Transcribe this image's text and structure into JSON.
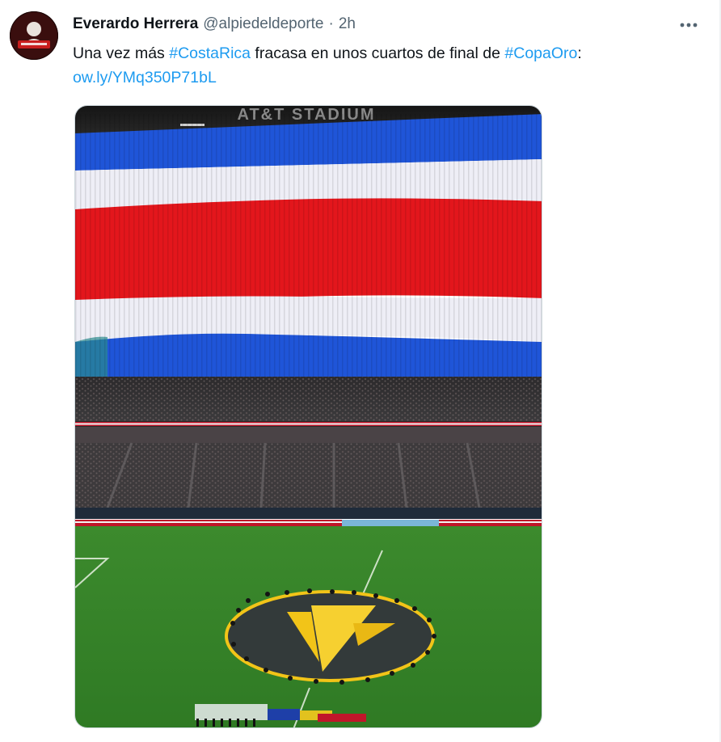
{
  "tweet": {
    "author_name": "Everardo Herrera",
    "author_handle": "@alpiedeldeporte",
    "separator": "·",
    "time": "2h",
    "text_part1": "Una vez más ",
    "hashtag1": "#CostaRica",
    "text_part2": " fracasa en unos cuartos de final de ",
    "hashtag2": "#CopaOro",
    "text_part3": ":",
    "link": "ow.ly/YMq350P71bL"
  },
  "media": {
    "stadium_sign": "AT&T STADIUM"
  },
  "icons": {
    "more": "more-horizontal-icon",
    "avatar": "profile-avatar"
  },
  "colors": {
    "accent": "#1d9bf0",
    "secondary_text": "#536471",
    "flag_blue": "#1f55d8",
    "flag_red": "#e3161c",
    "pitch": "#3f8a2e",
    "gold": "#f2c418"
  }
}
